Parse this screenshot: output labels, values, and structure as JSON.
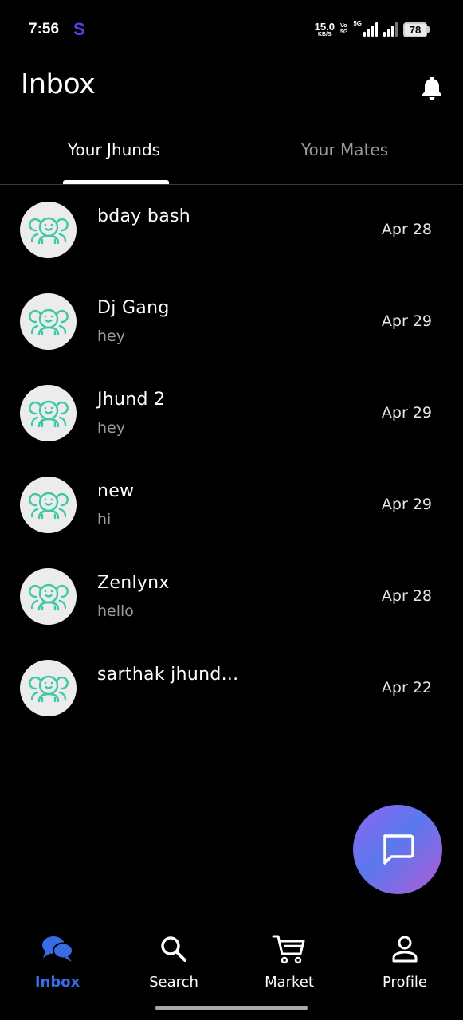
{
  "status_bar": {
    "time": "7:56",
    "app_letter": "S",
    "net_speed_value": "15.0",
    "net_speed_unit": "KB/S",
    "volte_top": "Vo",
    "volte_bottom": "5G",
    "five_g": "5G",
    "battery": "78"
  },
  "header": {
    "title": "Inbox",
    "bell_icon": "bell-icon"
  },
  "tabs": [
    {
      "label": "Your Jhunds",
      "active": true
    },
    {
      "label": "Your Mates",
      "active": false
    }
  ],
  "chats": [
    {
      "name": "bday bash",
      "message": "",
      "date": "Apr 28"
    },
    {
      "name": "Dj Gang",
      "message": "hey",
      "date": "Apr 29"
    },
    {
      "name": "Jhund 2",
      "message": "hey",
      "date": "Apr 29"
    },
    {
      "name": "new",
      "message": "hi",
      "date": "Apr 29"
    },
    {
      "name": "Zenlynx",
      "message": "hello",
      "date": "Apr 28"
    },
    {
      "name": "sarthak jhund...",
      "message": "",
      "date": "Apr 22"
    }
  ],
  "fab": {
    "icon": "chat-bubble-icon"
  },
  "bottom_nav": [
    {
      "label": "Inbox",
      "icon": "chat-bubbles-icon",
      "active": true
    },
    {
      "label": "Search",
      "icon": "search-icon",
      "active": false
    },
    {
      "label": "Market",
      "icon": "cart-icon",
      "active": false
    },
    {
      "label": "Profile",
      "icon": "person-icon",
      "active": false
    }
  ],
  "colors": {
    "background": "#000000",
    "accent": "#3a6be6",
    "avatar_bg": "#ececec",
    "avatar_icon": "#3cc9a3",
    "muted_text": "#9a9a9a"
  }
}
